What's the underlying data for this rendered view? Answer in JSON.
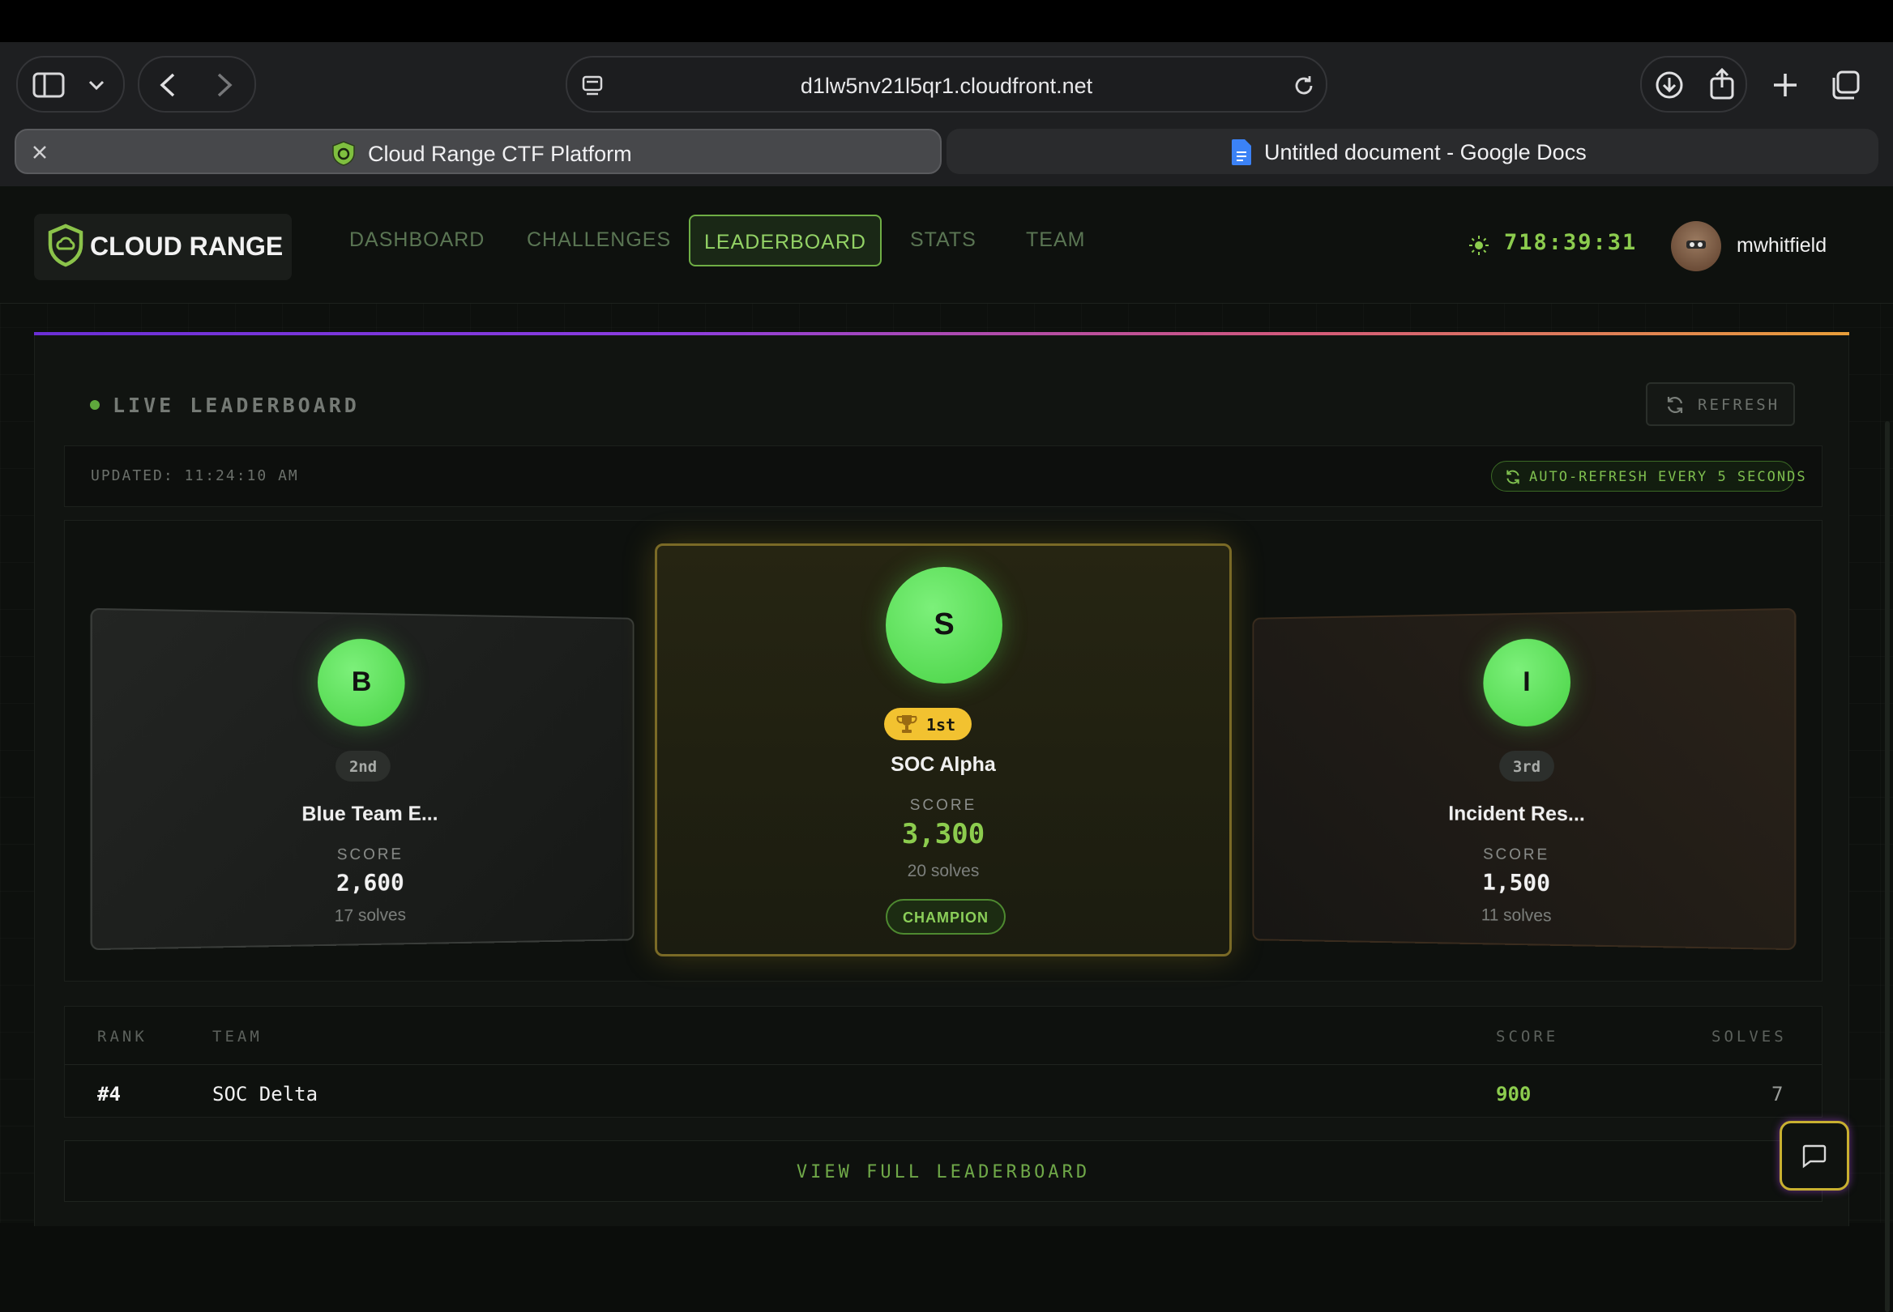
{
  "browser": {
    "url": "d1lw5nv21l5qr1.cloudfront.net",
    "tabs": [
      {
        "label": "Cloud Range CTF Platform",
        "active": true
      },
      {
        "label": "Untitled document - Google Docs",
        "active": false
      }
    ]
  },
  "nav": {
    "logo": "CLOUD RANGE",
    "links": [
      "DASHBOARD",
      "CHALLENGES",
      "LEADERBOARD",
      "STATS",
      "TEAM"
    ],
    "active": "LEADERBOARD",
    "timer": "718:39:31",
    "username": "mwhitfield"
  },
  "leaderboard": {
    "title": "LIVE LEADERBOARD",
    "refresh_label": "REFRESH",
    "updated": "UPDATED: 11:24:10 AM",
    "auto_refresh": "AUTO-REFRESH EVERY 5 SECONDS",
    "score_label": "SCORE",
    "podium": {
      "first": {
        "initial": "S",
        "rank": "1st",
        "name": "SOC Alpha",
        "score": "3,300",
        "solves": "20 solves",
        "badge": "CHAMPION"
      },
      "second": {
        "initial": "B",
        "rank": "2nd",
        "name": "Blue Team E...",
        "score": "2,600",
        "solves": "17 solves"
      },
      "third": {
        "initial": "I",
        "rank": "3rd",
        "name": "Incident Res...",
        "score": "1,500",
        "solves": "11 solves"
      }
    },
    "table": {
      "headers": [
        "RANK",
        "TEAM",
        "SCORE",
        "SOLVES"
      ],
      "rows": [
        {
          "rank": "#4",
          "team": "SOC Delta",
          "score": "900",
          "solves": "7"
        }
      ]
    },
    "view_full": "VIEW FULL LEADERBOARD"
  },
  "colors": {
    "accent": "#8ccc4e",
    "gold": "#f2c230",
    "background": "#0d100d"
  }
}
